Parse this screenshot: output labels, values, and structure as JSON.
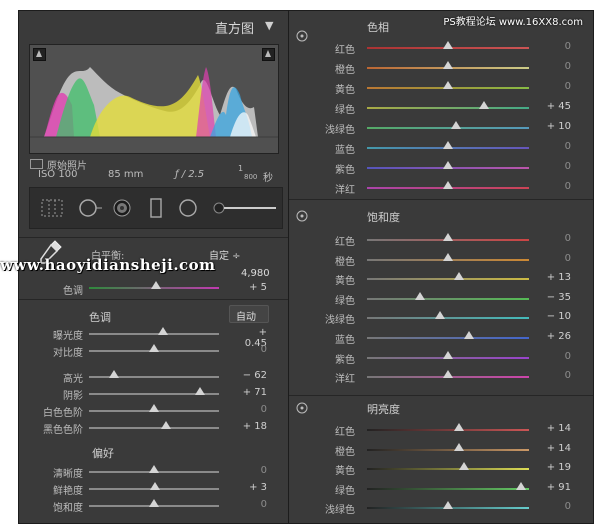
{
  "left_panel": {
    "histogram": {
      "title": "直方图",
      "iso": "ISO 100",
      "focal": "85 mm",
      "aperture": "ƒ / 2.5",
      "shutter_num": "1",
      "shutter_den": "800",
      "shutter_unit": "秒",
      "original_photo": "原始照片"
    },
    "basic": {
      "white_balance_label": "白平衡:",
      "white_balance_value": "自定 ÷",
      "color_temp_value": "4,980",
      "tint_label": "色调",
      "tint_value": "+ 5",
      "tone_label": "色调",
      "auto_label": "自动",
      "tone_rows": [
        {
          "label": "曝光度",
          "value": "+ 0.45",
          "pos": 0.57
        },
        {
          "label": "对比度",
          "value": "0",
          "pos": 0.5
        }
      ],
      "presence_rows": [
        {
          "label": "高光",
          "value": "− 62",
          "pos": 0.19
        },
        {
          "label": "阴影",
          "value": "+ 71",
          "pos": 0.85
        },
        {
          "label": "白色色阶",
          "value": "0",
          "pos": 0.5
        },
        {
          "label": "黑色色阶",
          "value": "+ 18",
          "pos": 0.59
        }
      ],
      "prefs_label": "偏好",
      "prefs_rows": [
        {
          "label": "清晰度",
          "value": "0",
          "pos": 0.5
        },
        {
          "label": "鲜艳度",
          "value": "+ 3",
          "pos": 0.51
        },
        {
          "label": "饱和度",
          "value": "0",
          "pos": 0.5
        }
      ]
    }
  },
  "right_panel": {
    "hue": {
      "title": "色相",
      "rows": [
        {
          "label": "红色",
          "value": "0",
          "pos": 0.5,
          "c1": "#a33",
          "c2": "#c55"
        },
        {
          "label": "橙色",
          "value": "0",
          "pos": 0.5,
          "c1": "#b63",
          "c2": "#cc8"
        },
        {
          "label": "黄色",
          "value": "0",
          "pos": 0.5,
          "c1": "#b73",
          "c2": "#8b4"
        },
        {
          "label": "绿色",
          "value": "+ 45",
          "pos": 0.72,
          "c1": "#aa4",
          "c2": "#4a8"
        },
        {
          "label": "浅绿色",
          "value": "+ 10",
          "pos": 0.55,
          "c1": "#5a6",
          "c2": "#59b"
        },
        {
          "label": "蓝色",
          "value": "0",
          "pos": 0.5,
          "c1": "#49a",
          "c2": "#65b"
        },
        {
          "label": "紫色",
          "value": "0",
          "pos": 0.5,
          "c1": "#55b",
          "c2": "#b5a"
        },
        {
          "label": "洋红",
          "value": "0",
          "pos": 0.5,
          "c1": "#a4a",
          "c2": "#c45"
        }
      ]
    },
    "saturation": {
      "title": "饱和度",
      "rows": [
        {
          "label": "红色",
          "value": "0",
          "pos": 0.5,
          "c1": "#777",
          "c2": "#c44"
        },
        {
          "label": "橙色",
          "value": "0",
          "pos": 0.5,
          "c1": "#777",
          "c2": "#c83"
        },
        {
          "label": "黄色",
          "value": "+ 13",
          "pos": 0.57,
          "c1": "#777",
          "c2": "#cb4"
        },
        {
          "label": "绿色",
          "value": "− 35",
          "pos": 0.33,
          "c1": "#777",
          "c2": "#5b5"
        },
        {
          "label": "浅绿色",
          "value": "− 10",
          "pos": 0.45,
          "c1": "#777",
          "c2": "#4bb"
        },
        {
          "label": "蓝色",
          "value": "+ 26",
          "pos": 0.63,
          "c1": "#777",
          "c2": "#46c"
        },
        {
          "label": "紫色",
          "value": "0",
          "pos": 0.5,
          "c1": "#777",
          "c2": "#94c"
        },
        {
          "label": "洋红",
          "value": "0",
          "pos": 0.5,
          "c1": "#777",
          "c2": "#c4a"
        }
      ]
    },
    "luminance": {
      "title": "明亮度",
      "rows": [
        {
          "label": "红色",
          "value": "+ 14",
          "pos": 0.57,
          "c1": "#222",
          "c2": "#c55"
        },
        {
          "label": "橙色",
          "value": "+ 14",
          "pos": 0.57,
          "c1": "#222",
          "c2": "#c96"
        },
        {
          "label": "黄色",
          "value": "+ 19",
          "pos": 0.6,
          "c1": "#222",
          "c2": "#dd5"
        },
        {
          "label": "绿色",
          "value": "+ 91",
          "pos": 0.95,
          "c1": "#222",
          "c2": "#6c6"
        },
        {
          "label": "浅绿色",
          "value": "0",
          "pos": 0.5,
          "c1": "#222",
          "c2": "#6cc"
        }
      ]
    }
  },
  "overlays": {
    "watermark_text": "www.haoyidiansheji.com",
    "ps_mark": "PS教程论坛 www.16XX8.com"
  }
}
